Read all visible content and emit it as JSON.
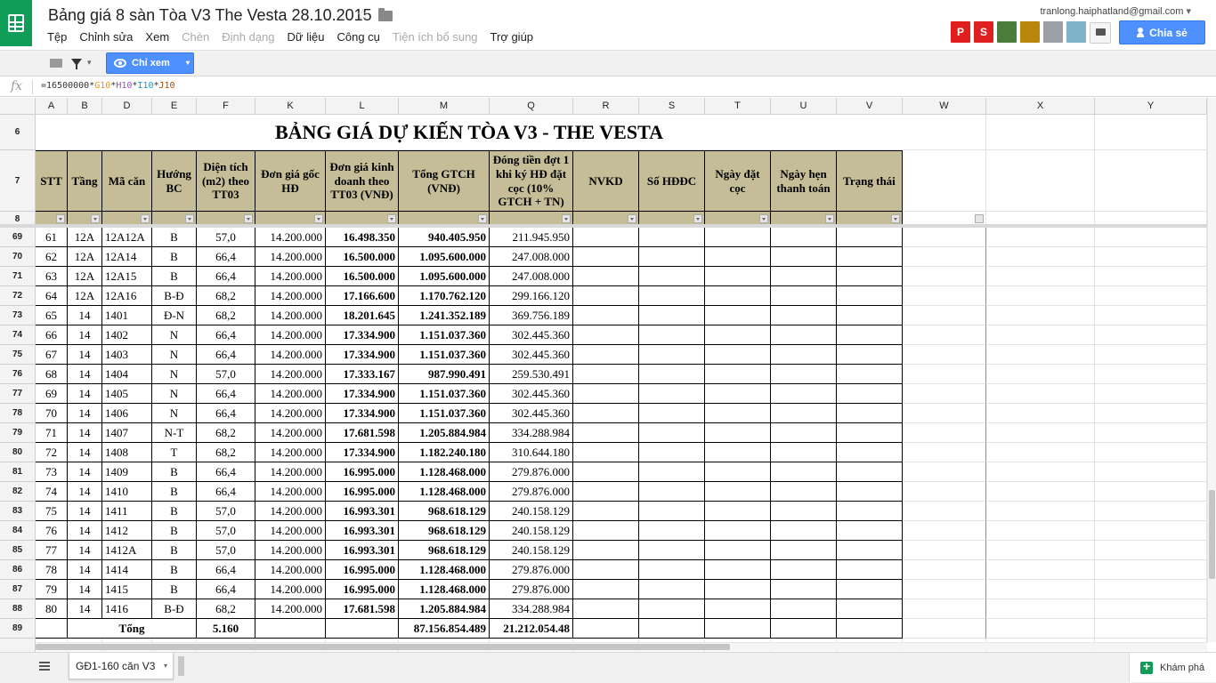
{
  "doc": {
    "title": "Bảng giá 8 sàn Tòa V3 The Vesta 28.10.2015",
    "user_email": "tranlong.haiphatland@gmail.com",
    "share_label": "Chia sẻ",
    "view_only_label": "Chỉ xem",
    "explore_label": "Khám phá",
    "sheet_tab": "GĐ1-160 căn V3",
    "formula": {
      "prefix": "=16500000*",
      "g": "G10",
      "h": "H10",
      "i": "I10",
      "j": "J10",
      "op": "*"
    }
  },
  "menu": [
    {
      "label": "Tệp",
      "enabled": true
    },
    {
      "label": "Chỉnh sửa",
      "enabled": true
    },
    {
      "label": "Xem",
      "enabled": true
    },
    {
      "label": "Chèn",
      "enabled": false
    },
    {
      "label": "Định dạng",
      "enabled": false
    },
    {
      "label": "Dữ liệu",
      "enabled": true
    },
    {
      "label": "Công cụ",
      "enabled": true
    },
    {
      "label": "Tiện ích bổ sung",
      "enabled": false
    },
    {
      "label": "Trợ giúp",
      "enabled": true
    }
  ],
  "addons": [
    {
      "name": "p-addon-icon",
      "glyph": "P",
      "color": "#e21d1d"
    },
    {
      "name": "swirl-addon-icon",
      "glyph": "S",
      "color": "#e02020"
    },
    {
      "name": "animal-addon-icon",
      "glyph": "",
      "color": "#4a7c3a"
    },
    {
      "name": "book-addon-icon",
      "glyph": "",
      "color": "#b8860b"
    },
    {
      "name": "person-addon-icon",
      "glyph": "",
      "color": "#9aa0a6"
    },
    {
      "name": "avatar-addon-icon",
      "glyph": "",
      "color": "#7fb3c8"
    }
  ],
  "columns": [
    "A",
    "B",
    "D",
    "E",
    "F",
    "K",
    "L",
    "M",
    "Q",
    "R",
    "S",
    "T",
    "U",
    "V",
    "W",
    "X",
    "Y"
  ],
  "sheet": {
    "title": "BẢNG GIÁ DỰ KIẾN TÒA V3 - THE VESTA",
    "headers": [
      "STT",
      "Tầng",
      "Mã căn",
      "Hướng BC",
      "Diện tích (m2) theo TT03",
      "Đơn giá gốc HĐ",
      "Đơn giá kinh doanh theo TT03 (VNĐ)",
      "Tổng GTCH (VNĐ)",
      "Đóng tiền đợt 1 khi ký HĐ đặt cọc  (10% GTCH + TN)",
      "NVKD",
      "Số HĐĐC",
      "Ngày đặt cọc",
      "Ngày hẹn thanh toán",
      "Trạng thái"
    ],
    "rows": [
      {
        "r": "69",
        "v": [
          "61",
          "12A",
          "12A12A",
          "B",
          "57,0",
          "14.200.000",
          "16.498.350",
          "940.405.950",
          "211.945.950"
        ]
      },
      {
        "r": "70",
        "v": [
          "62",
          "12A",
          "12A14",
          "B",
          "66,4",
          "14.200.000",
          "16.500.000",
          "1.095.600.000",
          "247.008.000"
        ]
      },
      {
        "r": "71",
        "v": [
          "63",
          "12A",
          "12A15",
          "B",
          "66,4",
          "14.200.000",
          "16.500.000",
          "1.095.600.000",
          "247.008.000"
        ]
      },
      {
        "r": "72",
        "v": [
          "64",
          "12A",
          "12A16",
          "B-Đ",
          "68,2",
          "14.200.000",
          "17.166.600",
          "1.170.762.120",
          "299.166.120"
        ]
      },
      {
        "r": "73",
        "v": [
          "65",
          "14",
          "1401",
          "Đ-N",
          "68,2",
          "14.200.000",
          "18.201.645",
          "1.241.352.189",
          "369.756.189"
        ]
      },
      {
        "r": "74",
        "v": [
          "66",
          "14",
          "1402",
          "N",
          "66,4",
          "14.200.000",
          "17.334.900",
          "1.151.037.360",
          "302.445.360"
        ]
      },
      {
        "r": "75",
        "v": [
          "67",
          "14",
          "1403",
          "N",
          "66,4",
          "14.200.000",
          "17.334.900",
          "1.151.037.360",
          "302.445.360"
        ]
      },
      {
        "r": "76",
        "v": [
          "68",
          "14",
          "1404",
          "N",
          "57,0",
          "14.200.000",
          "17.333.167",
          "987.990.491",
          "259.530.491"
        ]
      },
      {
        "r": "77",
        "v": [
          "69",
          "14",
          "1405",
          "N",
          "66,4",
          "14.200.000",
          "17.334.900",
          "1.151.037.360",
          "302.445.360"
        ]
      },
      {
        "r": "78",
        "v": [
          "70",
          "14",
          "1406",
          "N",
          "66,4",
          "14.200.000",
          "17.334.900",
          "1.151.037.360",
          "302.445.360"
        ]
      },
      {
        "r": "79",
        "v": [
          "71",
          "14",
          "1407",
          "N-T",
          "68,2",
          "14.200.000",
          "17.681.598",
          "1.205.884.984",
          "334.288.984"
        ]
      },
      {
        "r": "80",
        "v": [
          "72",
          "14",
          "1408",
          "T",
          "68,2",
          "14.200.000",
          "17.334.900",
          "1.182.240.180",
          "310.644.180"
        ]
      },
      {
        "r": "81",
        "v": [
          "73",
          "14",
          "1409",
          "B",
          "66,4",
          "14.200.000",
          "16.995.000",
          "1.128.468.000",
          "279.876.000"
        ]
      },
      {
        "r": "82",
        "v": [
          "74",
          "14",
          "1410",
          "B",
          "66,4",
          "14.200.000",
          "16.995.000",
          "1.128.468.000",
          "279.876.000"
        ]
      },
      {
        "r": "83",
        "v": [
          "75",
          "14",
          "1411",
          "B",
          "57,0",
          "14.200.000",
          "16.993.301",
          "968.618.129",
          "240.158.129"
        ]
      },
      {
        "r": "84",
        "v": [
          "76",
          "14",
          "1412",
          "B",
          "57,0",
          "14.200.000",
          "16.993.301",
          "968.618.129",
          "240.158.129"
        ]
      },
      {
        "r": "85",
        "v": [
          "77",
          "14",
          "1412A",
          "B",
          "57,0",
          "14.200.000",
          "16.993.301",
          "968.618.129",
          "240.158.129"
        ]
      },
      {
        "r": "86",
        "v": [
          "78",
          "14",
          "1414",
          "B",
          "66,4",
          "14.200.000",
          "16.995.000",
          "1.128.468.000",
          "279.876.000"
        ]
      },
      {
        "r": "87",
        "v": [
          "79",
          "14",
          "1415",
          "B",
          "66,4",
          "14.200.000",
          "16.995.000",
          "1.128.468.000",
          "279.876.000"
        ]
      },
      {
        "r": "88",
        "v": [
          "80",
          "14",
          "1416",
          "B-Đ",
          "68,2",
          "14.200.000",
          "17.681.598",
          "1.205.884.984",
          "334.288.984"
        ]
      }
    ],
    "total": {
      "r": "89",
      "label": "Tổng",
      "area": "5.160",
      "gtch": "87.156.854.489",
      "dot1": "21.212.054.48"
    },
    "row_labels": {
      "title": "6",
      "header": "7",
      "filter": "8"
    }
  }
}
